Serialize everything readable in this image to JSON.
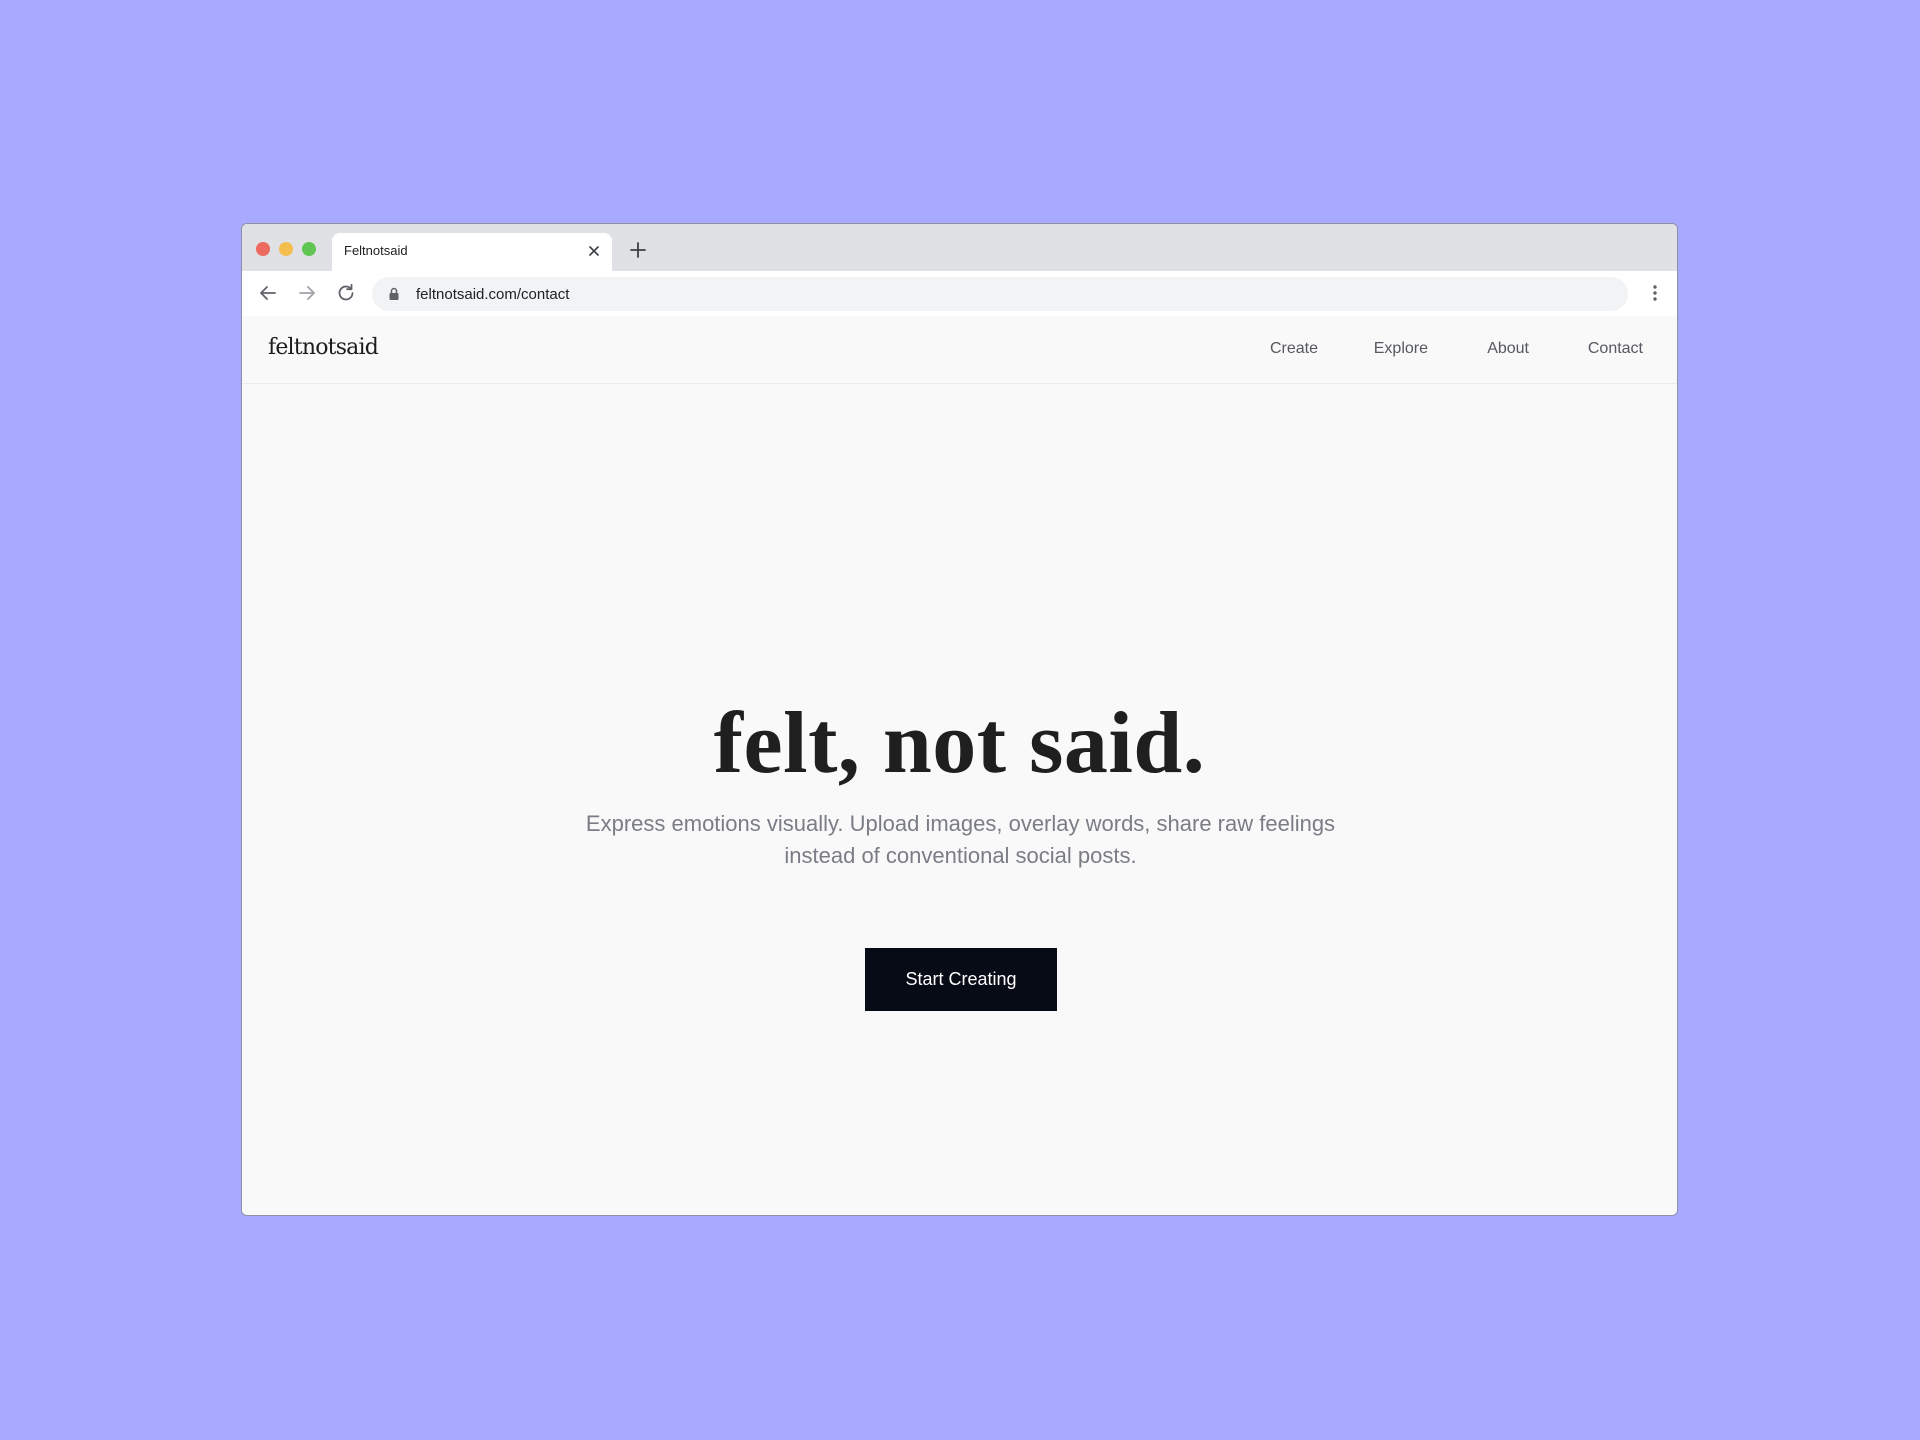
{
  "browser": {
    "tab_title": "Feltnotsaid",
    "url": "feltnotsaid.com/contact",
    "icons": {
      "tab_close": "close-icon",
      "new_tab": "plus-icon",
      "back": "arrow-left-icon",
      "forward": "arrow-right-icon",
      "reload": "reload-icon",
      "lock": "lock-icon",
      "menu": "more-vertical-icon"
    }
  },
  "site": {
    "logo": "feltnotsaid",
    "nav": [
      {
        "label": "Create"
      },
      {
        "label": "Explore"
      },
      {
        "label": "About"
      },
      {
        "label": "Contact"
      }
    ]
  },
  "hero": {
    "title": "felt, not said.",
    "subtitle": "Express emotions visually. Upload images, overlay words, share raw feelings instead of conventional social posts.",
    "cta_label": "Start Creating"
  },
  "colors": {
    "background": "#a8aaff",
    "page_bg": "#f9f9f9",
    "button_bg": "#070b16",
    "text_dark": "#1f1f1f",
    "text_muted": "#7a7d85"
  }
}
